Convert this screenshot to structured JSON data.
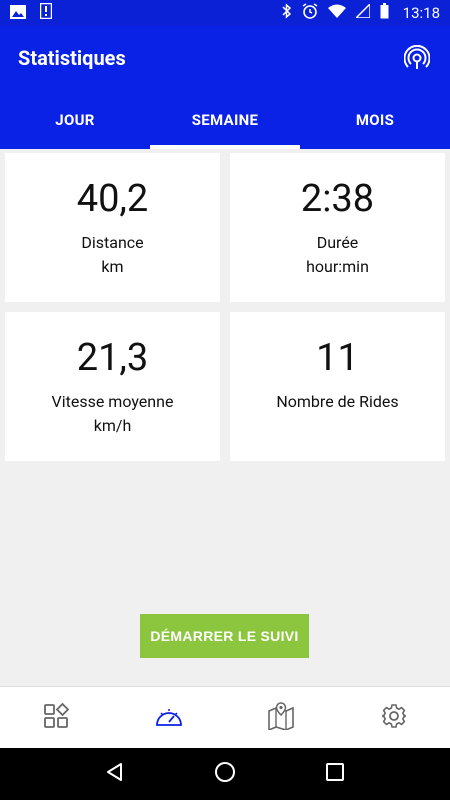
{
  "status_bar": {
    "time": "13:18",
    "left_icons": [
      "image-icon",
      "sim-icon"
    ],
    "right_icons": [
      "bluetooth-icon",
      "alarm-icon",
      "wifi-icon",
      "signal-icon",
      "battery-icon"
    ]
  },
  "app_bar": {
    "title": "Statistiques",
    "action_icon": "live-tracking-icon"
  },
  "tabs": [
    {
      "label": "JOUR",
      "active": false
    },
    {
      "label": "SEMAINE",
      "active": true
    },
    {
      "label": "MOIS",
      "active": false
    }
  ],
  "stats": [
    {
      "value": "40,2",
      "label": "Distance",
      "unit": "km"
    },
    {
      "value": "2:38",
      "label": "Durée",
      "unit": "hour:min"
    },
    {
      "value": "21,3",
      "label": "Vitesse moyenne",
      "unit": "km/h"
    },
    {
      "value": "11",
      "label": "Nombre de Rides",
      "unit": ""
    }
  ],
  "start_button": {
    "label": "DÉMARRER LE SUIVI"
  },
  "bottom_nav": [
    {
      "icon": "dashboard-icon",
      "active": false
    },
    {
      "icon": "speedometer-icon",
      "active": true
    },
    {
      "icon": "map-icon",
      "active": false
    },
    {
      "icon": "settings-icon",
      "active": false
    }
  ],
  "colors": {
    "primary": "#0a21e6",
    "status_bar": "#0a21d6",
    "accent_button": "#8cc63f",
    "nav_active": "#0a21e6",
    "nav_inactive": "#666666"
  }
}
